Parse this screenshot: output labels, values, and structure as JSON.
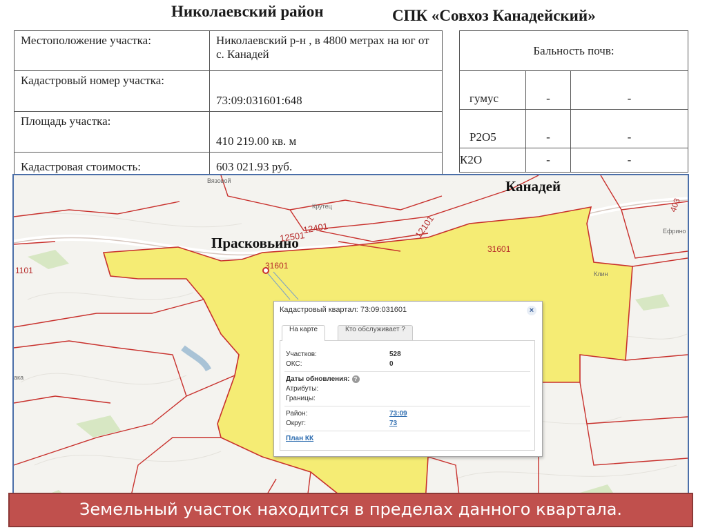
{
  "header": {
    "district": "Николаевский район",
    "farm": "СПК «Совхоз Канадейский»"
  },
  "info_table": {
    "rows": [
      {
        "label": "Местоположение участка:",
        "value": "Николаевский р-н , в 4800 метрах на юг от с. Канадей"
      },
      {
        "label": "Кадастровый номер участка:",
        "value": "73:09:031601:648"
      },
      {
        "label": "Площадь участка:",
        "value": "410 219.00 кв. м"
      },
      {
        "label": "Кадастровая стоимость:",
        "value": "603 021.93 руб."
      }
    ]
  },
  "soil_table": {
    "header": "Бальность почв:",
    "rows": [
      {
        "name": "гумус",
        "v1": "-",
        "v2": "-"
      },
      {
        "name": "Р2О5",
        "v1": "-",
        "v2": "-"
      },
      {
        "name": "К2О",
        "v1": "-",
        "v2": "-"
      }
    ]
  },
  "map": {
    "village_kanadey": "Канадей",
    "village_praskovyino": "Прасковьино",
    "parcel_label_main": "31601",
    "parcel_label_east": "31601",
    "block_12401": "12401",
    "block_12501": "12501",
    "block_12101": "12101",
    "block_1101": "1101",
    "block_403": "403",
    "small_vyazovoy": "Вязовой",
    "small_krutets": "Крутец",
    "small_klin": "Клин",
    "small_efrino": "Ефрино",
    "small_ka": "ака",
    "colors": {
      "parcel_fill": "#f5ec74",
      "boundary": "#c8302c",
      "road": "#d9c9c0"
    }
  },
  "popup": {
    "title": "Кадастровый квартал: 73:09:031601",
    "close": "×",
    "tab_active": "На карте",
    "tab_inactive": "Кто обслуживает ?",
    "parcels_label": "Участков:",
    "parcels_value": "528",
    "oks_label": "ОКС:",
    "oks_value": "0",
    "update_dates": "Даты обновления:",
    "help": "?",
    "attributes": "Атрибуты:",
    "borders": "Границы:",
    "region_label": "Район:",
    "region_value": "73:09",
    "okrug_label": "Округ:",
    "okrug_value": "73",
    "plan_link": "План КК"
  },
  "banner": "Земельный участок находится в пределах данного квартала."
}
